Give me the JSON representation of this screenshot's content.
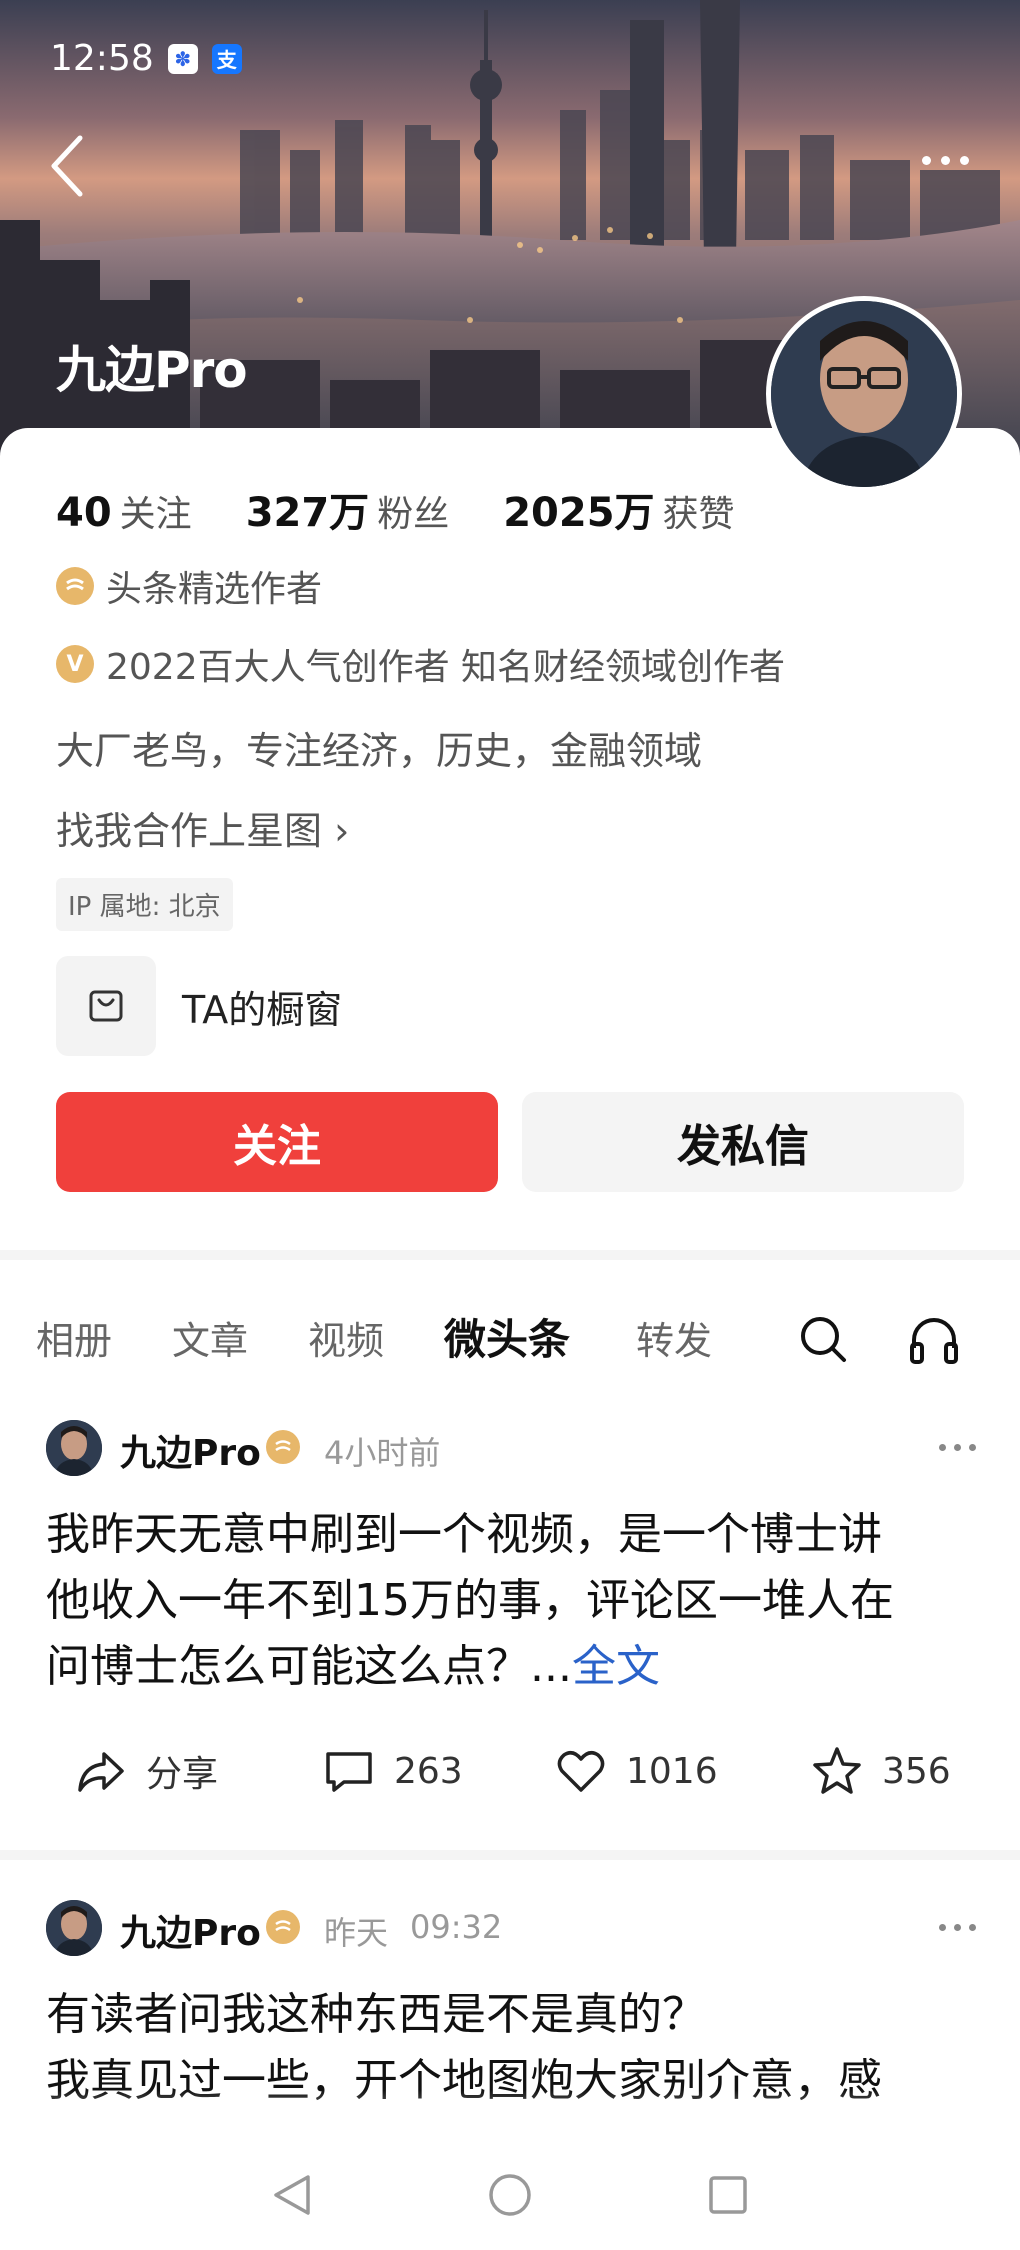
{
  "status_bar": {
    "time": "12:58"
  },
  "profile": {
    "name": "九边Pro",
    "stats": [
      {
        "value": "40",
        "label": "关注"
      },
      {
        "value": "327万",
        "label": "粉丝"
      },
      {
        "value": "2025万",
        "label": "获赞"
      }
    ],
    "badges": [
      {
        "icon": "toutiao-badge-icon",
        "text": "头条精选作者"
      },
      {
        "icon": "v-badge-icon",
        "text": "2022百大人气创作者 知名财经领域创作者"
      }
    ],
    "bio": "大厂老鸟，专注经济，历史，金融领域",
    "cooperation_link": "找我合作上星图 ›",
    "ip_location": "IP 属地: 北京",
    "shop_label": "TA的橱窗",
    "follow_label": "关注",
    "message_label": "发私信"
  },
  "tabs": [
    {
      "label": "相册",
      "active": false
    },
    {
      "label": "文章",
      "active": false
    },
    {
      "label": "视频",
      "active": false
    },
    {
      "label": "微头条",
      "active": true
    },
    {
      "label": "转发",
      "active": false
    }
  ],
  "posts": [
    {
      "author": "九边Pro",
      "time": "4小时前",
      "lines": [
        "我昨天无意中刷到一个视频，是一个博士讲",
        "他收入一年不到15万的事，评论区一堆人在",
        "问博士怎么可能这么点？..."
      ],
      "more_link": "全文",
      "share_label": "分享",
      "comments": "263",
      "likes": "1016",
      "favorites": "356"
    },
    {
      "author": "九边Pro",
      "date": "昨天",
      "time": "09:32",
      "lines": [
        "有读者问我这种东西是不是真的？",
        "我真见过一些，开个地图炮大家别介意，感"
      ]
    }
  ],
  "colors": {
    "accent": "#f0403c",
    "link": "#2a62c9",
    "badge_gold": "#e7b76a"
  }
}
